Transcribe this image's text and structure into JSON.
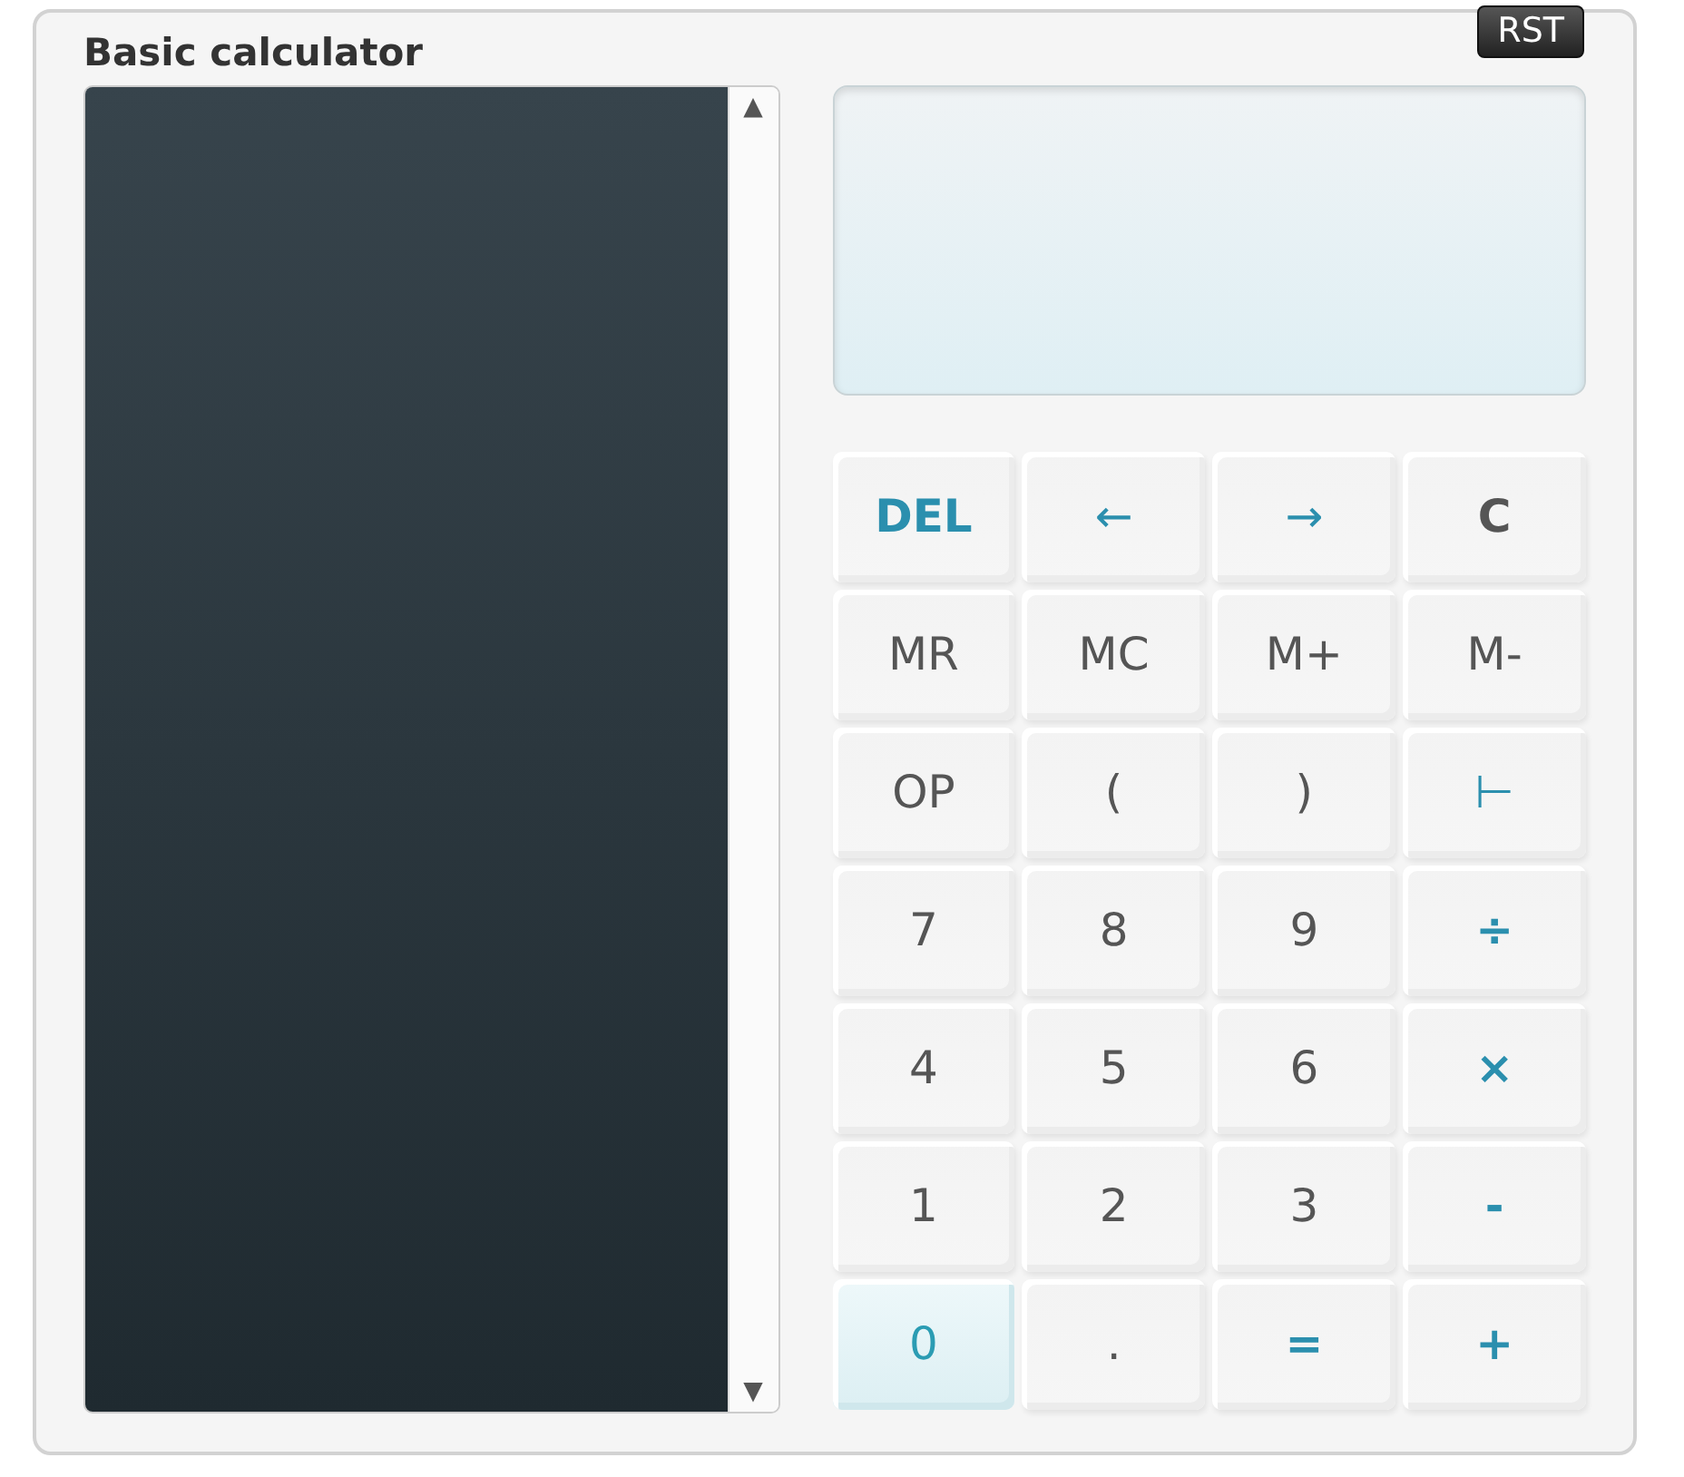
{
  "title": "Basic calculator",
  "reset_button": "RST",
  "history_panel": {
    "scroll_up": "▲",
    "scroll_down": "▼"
  },
  "keys": [
    {
      "label": "DEL",
      "kind": "command",
      "selected": false
    },
    {
      "label": "←",
      "kind": "cursor",
      "selected": false
    },
    {
      "label": "→",
      "kind": "cursor",
      "selected": false
    },
    {
      "label": "C",
      "kind": "clear",
      "selected": false
    },
    {
      "label": "MR",
      "kind": "normal",
      "selected": false
    },
    {
      "label": "MC",
      "kind": "normal",
      "selected": false
    },
    {
      "label": "M+",
      "kind": "normal",
      "selected": false
    },
    {
      "label": "M-",
      "kind": "normal",
      "selected": false
    },
    {
      "label": "OP",
      "kind": "normal",
      "selected": false
    },
    {
      "label": "(",
      "kind": "normal",
      "selected": false
    },
    {
      "label": ")",
      "kind": "normal",
      "selected": false
    },
    {
      "label": "⊢",
      "kind": "cursor",
      "selected": false
    },
    {
      "label": "7",
      "kind": "normal",
      "selected": false
    },
    {
      "label": "8",
      "kind": "normal",
      "selected": false
    },
    {
      "label": "9",
      "kind": "normal",
      "selected": false
    },
    {
      "label": "÷",
      "kind": "operator",
      "selected": false
    },
    {
      "label": "4",
      "kind": "normal",
      "selected": false
    },
    {
      "label": "5",
      "kind": "normal",
      "selected": false
    },
    {
      "label": "6",
      "kind": "normal",
      "selected": false
    },
    {
      "label": "×",
      "kind": "operator",
      "selected": false
    },
    {
      "label": "1",
      "kind": "normal",
      "selected": false
    },
    {
      "label": "2",
      "kind": "normal",
      "selected": false
    },
    {
      "label": "3",
      "kind": "normal",
      "selected": false
    },
    {
      "label": "-",
      "kind": "operator",
      "selected": false
    },
    {
      "label": "0",
      "kind": "normal",
      "selected": true
    },
    {
      "label": ".",
      "kind": "normal",
      "selected": false
    },
    {
      "label": "=",
      "kind": "operator",
      "selected": false
    },
    {
      "label": "+",
      "kind": "operator",
      "selected": false
    }
  ]
}
